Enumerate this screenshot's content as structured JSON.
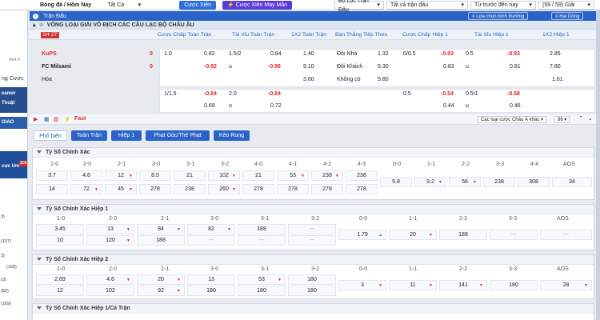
{
  "topbar": {
    "sport": "Bóng đá / Hôm Nay",
    "filter_all": "Tất Cả",
    "btn_xien": "Cược Xiên",
    "btn_may_man": "Cược Xiên May Mắn",
    "filter_league": "Bộ Lọc Trận Đấu",
    "filter_all_matches": "Tất cả trận đấu",
    "sort": "Từ trước đến nay",
    "league_count": "(59 / 59) Giải",
    "accent": "#2b64c8"
  },
  "left": {
    "item1": "INH 0",
    "item2": "ng Cược",
    "promo1": "eamer",
    "promo2": "Thuật",
    "promo3": "GIAO",
    "promo4": "cực lớn",
    "badge": "119",
    "counts": [
      "(107)",
      "(100)",
      "(82)",
      "(169)",
      "3)",
      "3)",
      "(3)"
    ]
  },
  "header": {
    "title": "Trận Đấu",
    "right1": "Lựa chọn bình thường",
    "right2": "Hai Dòng"
  },
  "league": "VÒNG LOẠI GIẢI VÔ ĐỊCH CÁC CÂU LẠC BỘ CHÂU ÂU",
  "odds_headers": [
    "Cược Chấp Toàn Trận",
    "Tài Xỉu Toàn Trận",
    "1X2 Toàn Trận",
    "Bàn Thắng Tiếp Theo",
    "Cược Chấp Hiệp 1",
    "Tài Xỉu Hiệp 1",
    "1X2 Hiệp 1"
  ],
  "live_time": "1H 27'",
  "match": {
    "home": "KuPS",
    "away": "FC Milsami",
    "draw": "Hòa",
    "home_score": "0",
    "away_score": "0"
  },
  "odds": {
    "r1": [
      "1.0",
      "0.82",
      "1.5/2",
      "0.84",
      "1.40",
      "Đội Nhà",
      "1.32",
      "0/0.5",
      "-0.93",
      "0.5",
      "-0.93",
      "2.85"
    ],
    "r2": [
      "-0.92",
      "u",
      "-0.96",
      "9.10",
      "Đội Khách",
      "5.30",
      "0.83",
      "u",
      "0.81",
      "7.80"
    ],
    "r3": [
      "3.60",
      "Không có",
      "5.80",
      "1.61"
    ],
    "r4": [
      "1/1.5",
      "-0.84",
      "2.0",
      "-0.84",
      "0.5",
      "-0.54",
      "0.5/1",
      "-0.58"
    ],
    "r5": [
      "0.69",
      "u",
      "0.72",
      "0.44",
      "u",
      "0.46"
    ]
  },
  "controls": {
    "fast": "Fast",
    "asian": "Các loại cược Châu Á khác",
    "count": "86"
  },
  "tabs": [
    "Phổ biến",
    "Toàn Trận",
    "Hiệp 1",
    "Phạt Góc/Thẻ Phạt",
    "Kèo Rung"
  ],
  "sections": {
    "s1": {
      "title": "Tỷ Số Chính Xác",
      "heads": [
        "1-0",
        "2-0",
        "2-1",
        "3-0",
        "3-1",
        "3-2",
        "4-0",
        "4-1",
        "4-2",
        "4-3",
        "0-0",
        "1-1",
        "2-2",
        "3-3",
        "4-4",
        "AOS"
      ],
      "row1": [
        "3.7",
        "4.6",
        "12",
        "8.5",
        "21",
        "102",
        "21",
        "53",
        "238",
        "238"
      ],
      "row2": [
        "14",
        "72",
        "45",
        "278",
        "238",
        "260",
        "278",
        "278",
        "278",
        "278"
      ],
      "draws": [
        "5.8",
        "9.2",
        "56",
        "238",
        "308",
        "34"
      ]
    },
    "s2": {
      "title": "Tỷ Số Chính Xác Hiệp 1",
      "heads": [
        "1-0",
        "2-0",
        "2-1",
        "3-0",
        "3-1",
        "3-2",
        "0-0",
        "1-1",
        "2-2",
        "3-3",
        "AOS"
      ],
      "row1": [
        "3.45",
        "13",
        "84",
        "82",
        "188",
        "---"
      ],
      "row2": [
        "10",
        "120",
        "188",
        "---",
        "---",
        "---"
      ],
      "draws": [
        "1.79",
        "20",
        "188",
        "---",
        "---"
      ]
    },
    "s3": {
      "title": "Tỷ Số Chính Xác Hiệp 2",
      "heads": [
        "1-0",
        "2-0",
        "2-1",
        "3-0",
        "3-1",
        "3-2",
        "0-0",
        "1-1",
        "2-2",
        "3-3",
        "AOS"
      ],
      "row1": [
        "2.69",
        "4.6",
        "20",
        "13",
        "53",
        "180"
      ],
      "row2": [
        "12",
        "102",
        "92",
        "180",
        "180",
        "180"
      ],
      "draws": [
        "3",
        "11",
        "141",
        "180",
        "28"
      ]
    },
    "s4": {
      "title": "Tỷ Số Chính Xác Hiệp 1/Cả Trận"
    }
  }
}
